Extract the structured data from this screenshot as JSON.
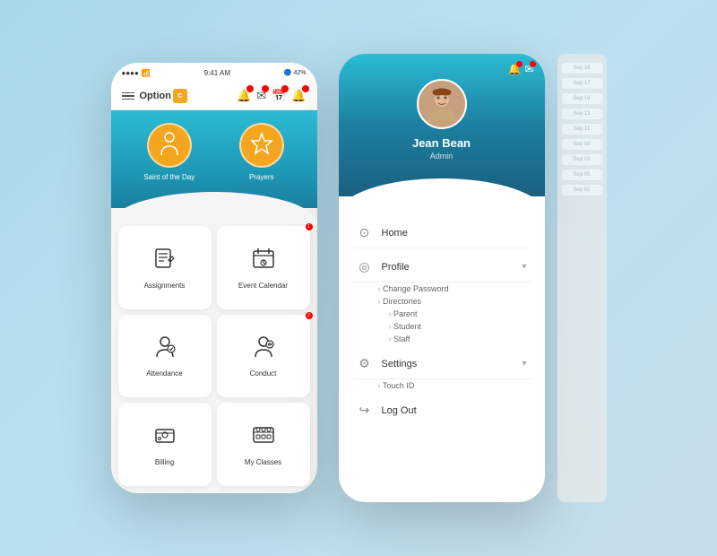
{
  "app": {
    "name": "Option",
    "badge": "C",
    "status_time": "9:41 AM",
    "status_battery": "42%",
    "status_signal": "●●●●"
  },
  "hero": {
    "saint_label": "Saint of the Day",
    "prayers_label": "Prayers"
  },
  "grid": {
    "items": [
      {
        "id": "assignments",
        "label": "Assignments",
        "notif": false
      },
      {
        "id": "event-calendar",
        "label": "Event Calendar",
        "notif": true
      },
      {
        "id": "attendance",
        "label": "Attendance",
        "notif": false
      },
      {
        "id": "conduct",
        "label": "Conduct",
        "notif": true
      },
      {
        "id": "billing",
        "label": "Billing",
        "notif": false
      },
      {
        "id": "my-classes",
        "label": "My Classes",
        "notif": false
      }
    ]
  },
  "profile": {
    "name": "Jean Bean",
    "role": "Admin",
    "avatar_icon": "👤"
  },
  "menu": {
    "items": [
      {
        "id": "home",
        "label": "Home",
        "icon": "⊙",
        "expandable": false
      },
      {
        "id": "profile",
        "label": "Profile",
        "icon": "◎",
        "expandable": true,
        "sub": [
          "Change Password",
          "Directories",
          "Parent",
          "Student",
          "Staff"
        ]
      },
      {
        "id": "settings",
        "label": "Settings",
        "icon": "⚙",
        "expandable": true,
        "sub": [
          "Touch ID"
        ]
      },
      {
        "id": "logout",
        "label": "Log Out",
        "icon": "⇒",
        "expandable": false
      }
    ]
  },
  "calendar": {
    "entries": [
      "Sep 18",
      "Sep 17",
      "Sep 16",
      "Sep 13",
      "Sep 11",
      "Sep 09",
      "Sep 08",
      "Sep 05",
      "Sep 02"
    ]
  },
  "colors": {
    "accent_blue": "#2bbcd4",
    "accent_orange": "#f4a620",
    "text_dark": "#333333",
    "text_muted": "#888888",
    "background": "#f5f5f5"
  }
}
